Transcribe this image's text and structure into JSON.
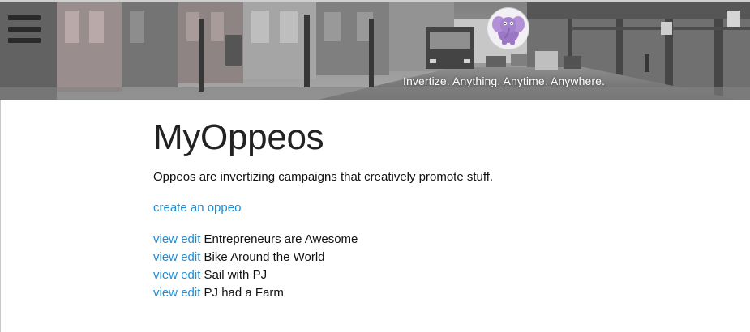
{
  "header": {
    "tagline": "Invertize. Anything. Anytime. Anywhere."
  },
  "main": {
    "title": "MyOppeos",
    "intro": "Oppeos are invertizing campaigns that creatively promote stuff.",
    "create_link": "create an oppeo",
    "oppeos": [
      {
        "view": "view",
        "edit": "edit",
        "name": "Entrepreneurs are Awesome"
      },
      {
        "view": "view",
        "edit": "edit",
        "name": "Bike Around the World"
      },
      {
        "view": "view",
        "edit": "edit",
        "name": "Sail with PJ"
      },
      {
        "view": "view",
        "edit": "edit",
        "name": "PJ had a Farm"
      }
    ]
  },
  "colors": {
    "link": "#1f8dd6",
    "text": "#111111",
    "title": "#222222"
  },
  "icons": {
    "menu": "hamburger-menu-icon",
    "logo": "purple-elephant-logo"
  }
}
